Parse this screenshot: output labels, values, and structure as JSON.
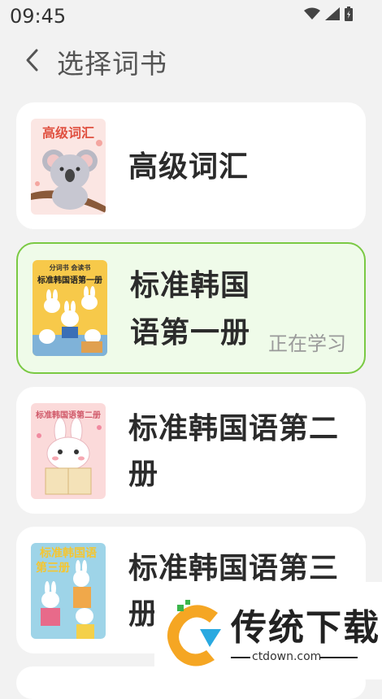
{
  "status_bar": {
    "time": "09:45"
  },
  "header": {
    "title": "选择词书"
  },
  "books": [
    {
      "title": "高级词汇",
      "cover_text": "高级词汇",
      "badge": ""
    },
    {
      "title_line1": "标准韩国",
      "title_line2": "语第一册",
      "cover_top": "分词书 会读书",
      "cover_text": "标准韩国语第一册",
      "badge": "正在学习"
    },
    {
      "title_line1": "标准韩国语第二",
      "title_line2": "册",
      "cover_text": "标准韩国语第二册",
      "badge": ""
    },
    {
      "title_line1": "标准韩国语第三",
      "title_line2": "册",
      "cover_text_1": "标准韩国语",
      "cover_text_2": "第三册",
      "badge": ""
    }
  ],
  "watermark": {
    "brand": "传统下载",
    "url": "ctdown.com"
  },
  "colors": {
    "accent": "#7ac943",
    "active_bg": "#effbe9"
  }
}
